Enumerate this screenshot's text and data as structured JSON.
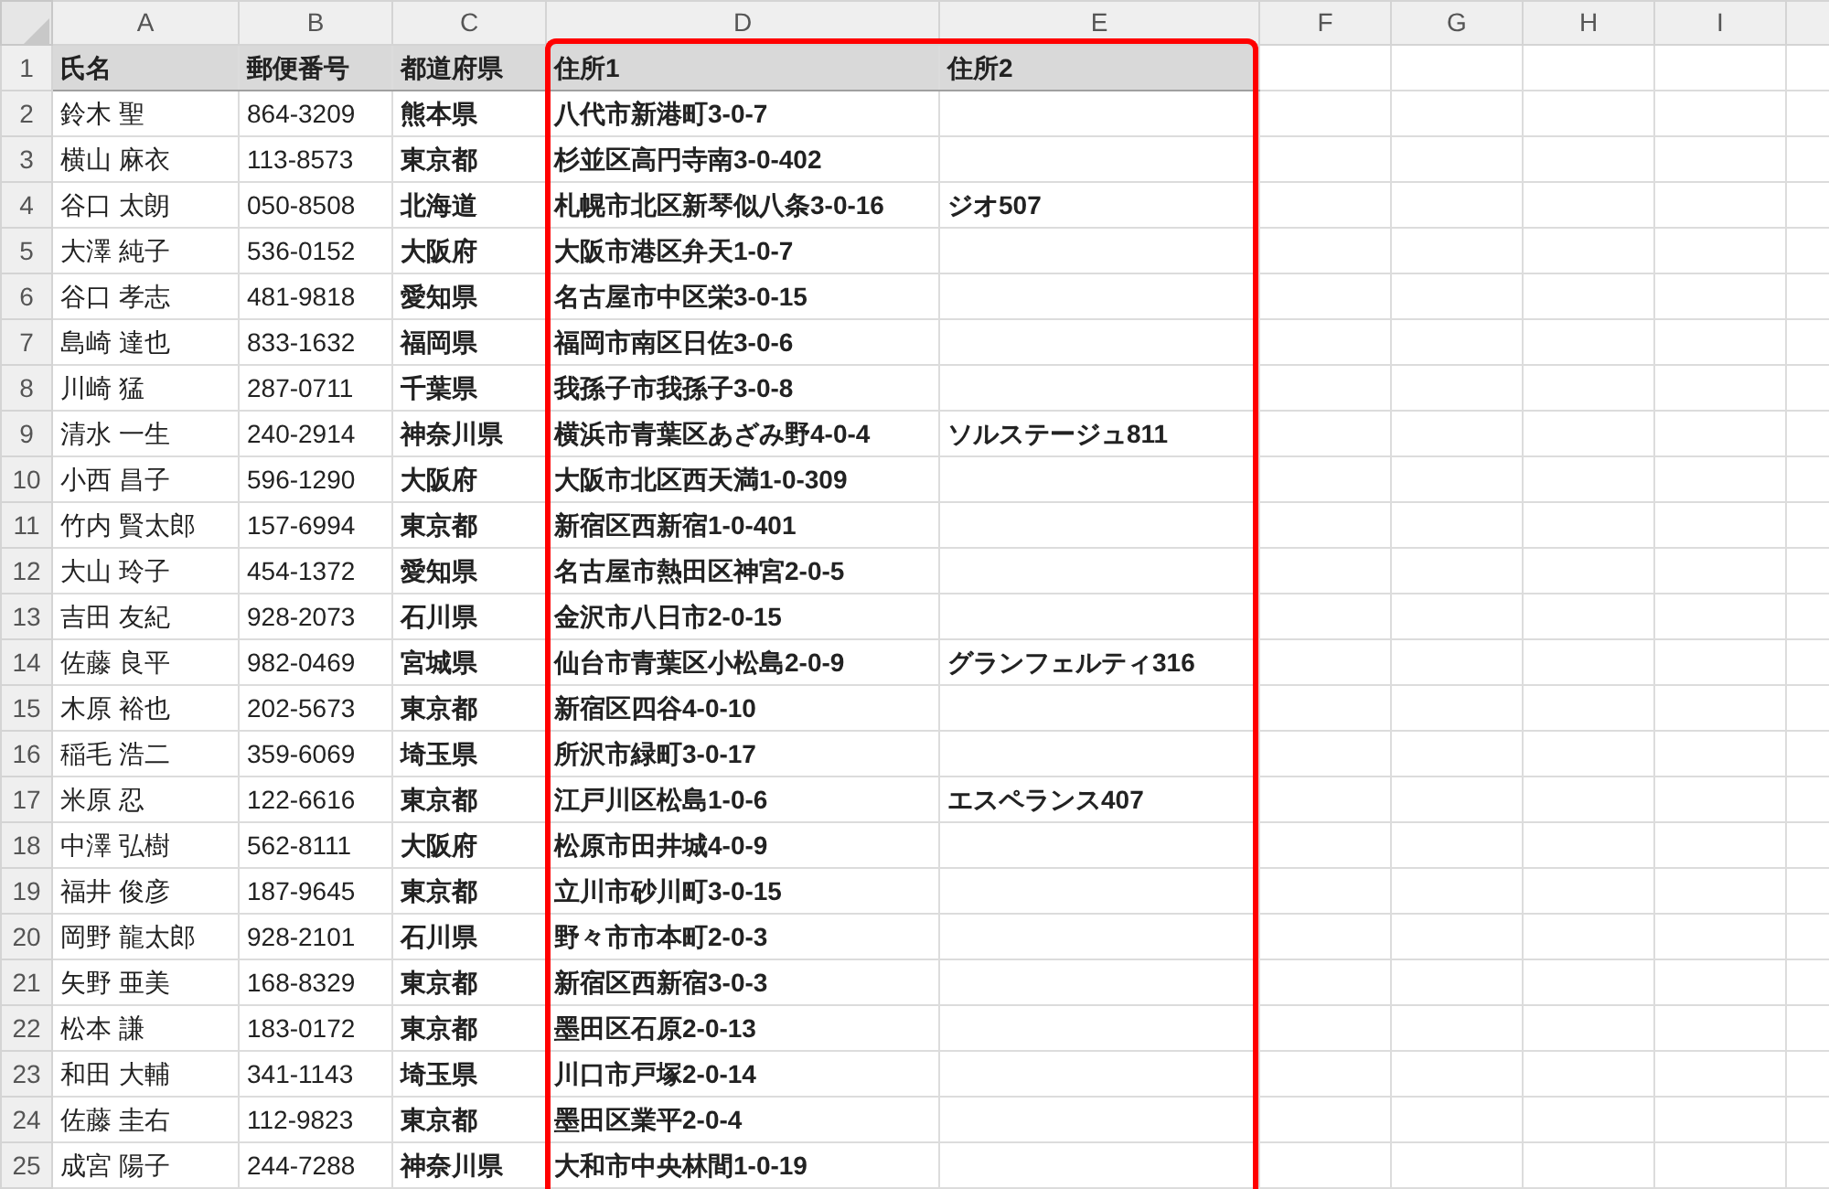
{
  "columns": [
    {
      "letter": "A",
      "bold": false,
      "highlighted": false
    },
    {
      "letter": "B",
      "bold": false,
      "highlighted": false
    },
    {
      "letter": "C",
      "bold": true,
      "highlighted": false
    },
    {
      "letter": "D",
      "bold": true,
      "highlighted": true
    },
    {
      "letter": "E",
      "bold": true,
      "highlighted": true
    },
    {
      "letter": "F",
      "highlighted": false
    },
    {
      "letter": "G",
      "highlighted": false
    },
    {
      "letter": "H",
      "highlighted": false
    },
    {
      "letter": "I",
      "highlighted": false
    }
  ],
  "rows": [
    {
      "number": "1",
      "kind": "header",
      "cells": [
        "氏名",
        "郵便番号",
        "都道府県",
        "住所1",
        "住所2"
      ]
    },
    {
      "number": "2",
      "kind": "data",
      "cells": [
        "鈴木 聖",
        "864-3209",
        "熊本県",
        "八代市新港町3-0-7",
        null
      ]
    },
    {
      "number": "3",
      "kind": "data",
      "cells": [
        "横山 麻衣",
        "113-8573",
        "東京都",
        "杉並区高円寺南3-0-402",
        null
      ]
    },
    {
      "number": "4",
      "kind": "data",
      "cells": [
        "谷口 太朗",
        "050-8508",
        "北海道",
        "札幌市北区新琴似八条3-0-16",
        "ジオ507"
      ]
    },
    {
      "number": "5",
      "kind": "data",
      "cells": [
        "大澤 純子",
        "536-0152",
        "大阪府",
        "大阪市港区弁天1-0-7",
        null
      ]
    },
    {
      "number": "6",
      "kind": "data",
      "cells": [
        "谷口 孝志",
        "481-9818",
        "愛知県",
        "名古屋市中区栄3-0-15",
        null
      ]
    },
    {
      "number": "7",
      "kind": "data",
      "cells": [
        "島崎 達也",
        "833-1632",
        "福岡県",
        "福岡市南区日佐3-0-6",
        null
      ]
    },
    {
      "number": "8",
      "kind": "data",
      "cells": [
        "川崎 猛",
        "287-0711",
        "千葉県",
        "我孫子市我孫子3-0-8",
        null
      ]
    },
    {
      "number": "9",
      "kind": "data",
      "cells": [
        "清水 一生",
        "240-2914",
        "神奈川県",
        "横浜市青葉区あざみ野4-0-4",
        "ソルステージュ811"
      ]
    },
    {
      "number": "10",
      "kind": "data",
      "cells": [
        "小西 昌子",
        "596-1290",
        "大阪府",
        "大阪市北区西天満1-0-309",
        null
      ]
    },
    {
      "number": "11",
      "kind": "data",
      "cells": [
        "竹内 賢太郎",
        "157-6994",
        "東京都",
        "新宿区西新宿1-0-401",
        null
      ]
    },
    {
      "number": "12",
      "kind": "data",
      "cells": [
        "大山 玲子",
        "454-1372",
        "愛知県",
        "名古屋市熱田区神宮2-0-5",
        null
      ]
    },
    {
      "number": "13",
      "kind": "data",
      "cells": [
        "吉田 友紀",
        "928-2073",
        "石川県",
        "金沢市八日市2-0-15",
        null
      ]
    },
    {
      "number": "14",
      "kind": "data",
      "cells": [
        "佐藤 良平",
        "982-0469",
        "宮城県",
        "仙台市青葉区小松島2-0-9",
        "グランフェルティ316"
      ]
    },
    {
      "number": "15",
      "kind": "data",
      "cells": [
        "木原 裕也",
        "202-5673",
        "東京都",
        "新宿区四谷4-0-10",
        null
      ]
    },
    {
      "number": "16",
      "kind": "data",
      "cells": [
        "稲毛 浩二",
        "359-6069",
        "埼玉県",
        "所沢市緑町3-0-17",
        null
      ]
    },
    {
      "number": "17",
      "kind": "data",
      "cells": [
        "米原 忍",
        "122-6616",
        "東京都",
        "江戸川区松島1-0-6",
        "エスペランス407"
      ]
    },
    {
      "number": "18",
      "kind": "data",
      "cells": [
        "中澤 弘樹",
        "562-8111",
        "大阪府",
        "松原市田井城4-0-9",
        null
      ]
    },
    {
      "number": "19",
      "kind": "data",
      "cells": [
        "福井 俊彦",
        "187-9645",
        "東京都",
        "立川市砂川町3-0-15",
        null
      ]
    },
    {
      "number": "20",
      "kind": "data",
      "cells": [
        "岡野 龍太郎",
        "928-2101",
        "石川県",
        "野々市市本町2-0-3",
        null
      ]
    },
    {
      "number": "21",
      "kind": "data",
      "cells": [
        "矢野 亜美",
        "168-8329",
        "東京都",
        "新宿区西新宿3-0-3",
        null
      ]
    },
    {
      "number": "22",
      "kind": "data",
      "cells": [
        "松本 謙",
        "183-0172",
        "東京都",
        "墨田区石原2-0-13",
        null
      ]
    },
    {
      "number": "23",
      "kind": "data",
      "cells": [
        "和田 大輔",
        "341-1143",
        "埼玉県",
        "川口市戸塚2-0-14",
        null
      ]
    },
    {
      "number": "24",
      "kind": "data",
      "cells": [
        "佐藤 圭右",
        "112-9823",
        "東京都",
        "墨田区業平2-0-4",
        null
      ]
    },
    {
      "number": "25",
      "kind": "data",
      "cells": [
        "成宮 陽子",
        "244-7288",
        "神奈川県",
        "大和市中央林間1-0-19",
        null
      ]
    }
  ]
}
